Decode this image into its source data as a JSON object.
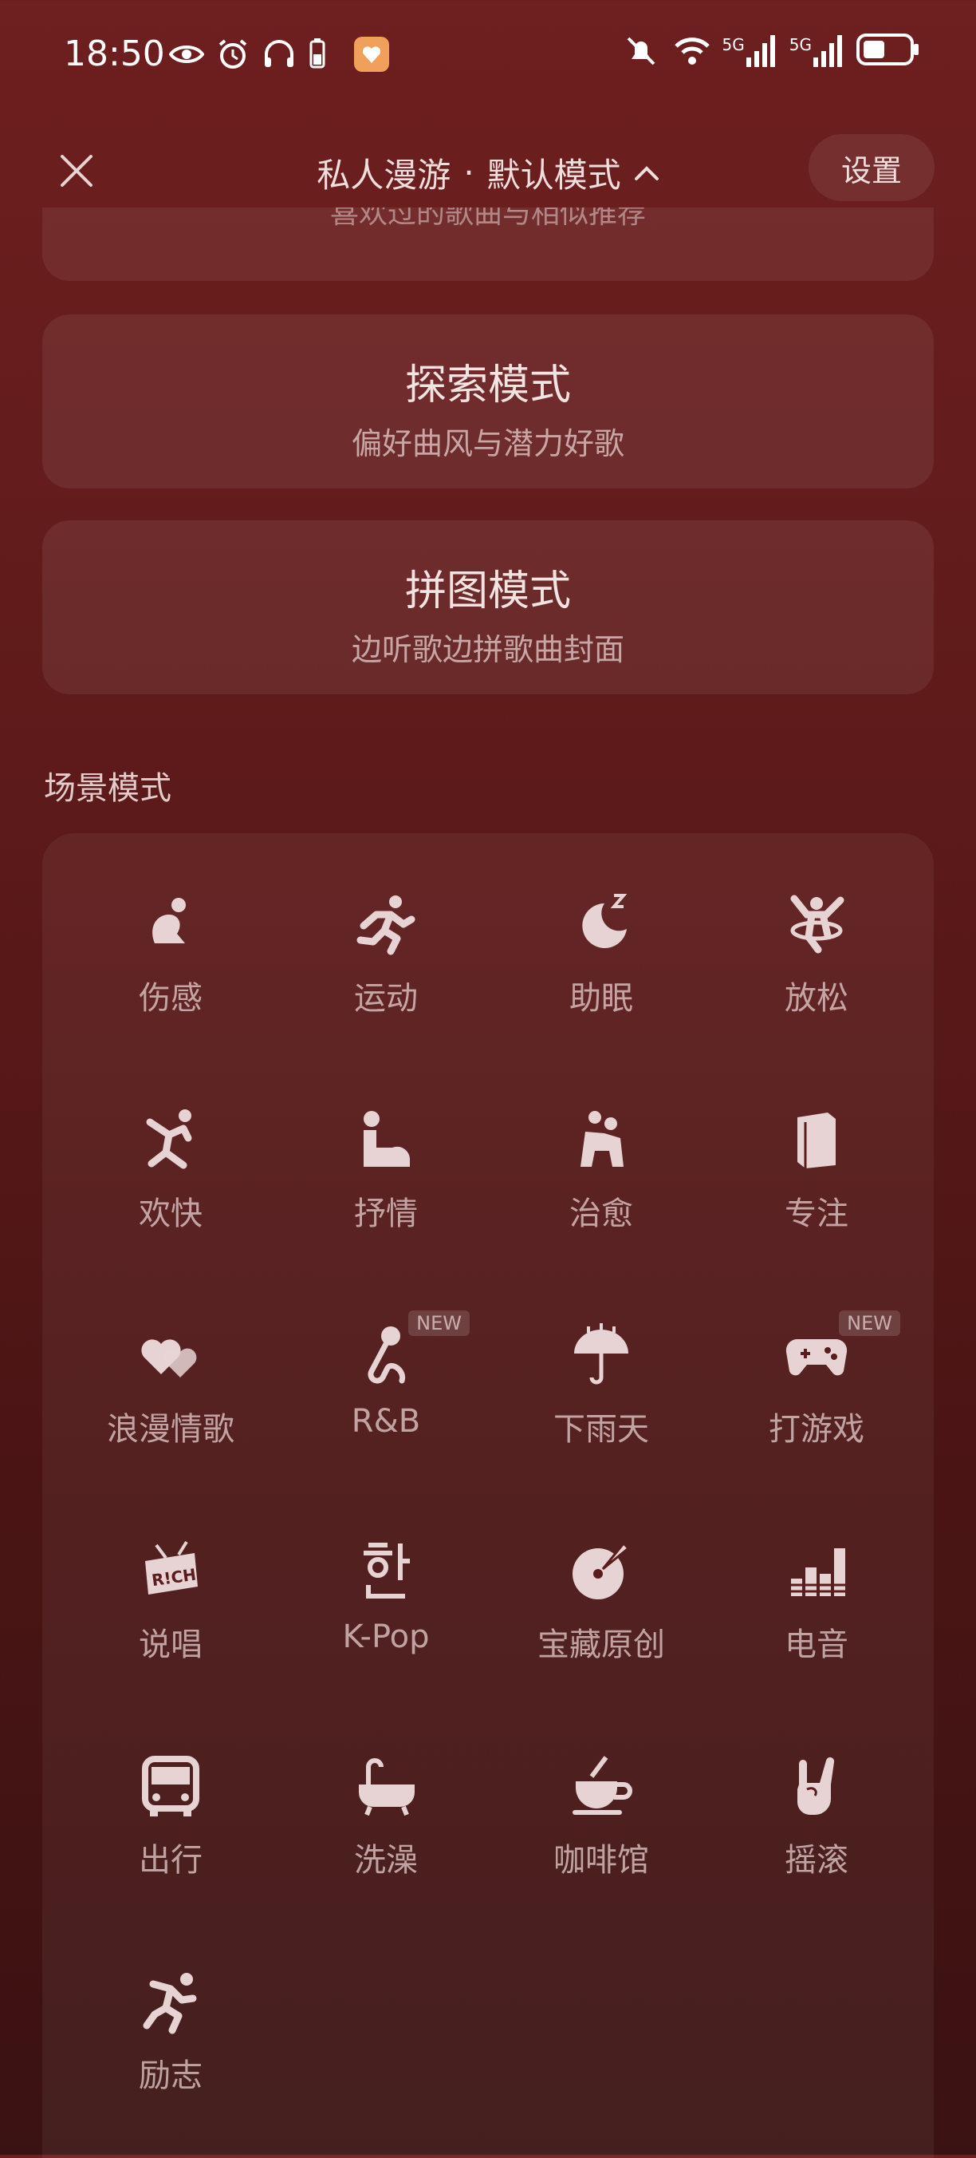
{
  "status": {
    "time": "18:50",
    "net_label_1": "5G",
    "net_label_2": "5G"
  },
  "header": {
    "title": "私人漫游",
    "separator": "·",
    "mode": "默认模式",
    "settings_label": "设置"
  },
  "modes": {
    "partial_sub": "喜欢过的歌曲与相似推荐",
    "explore": {
      "title": "探索模式",
      "sub": "偏好曲风与潜力好歌"
    },
    "puzzle": {
      "title": "拼图模式",
      "sub": "边听歌边拼歌曲封面"
    }
  },
  "scene": {
    "section_title": "场景模式",
    "new_label": "NEW",
    "items": [
      {
        "label": "伤感",
        "icon": "sad-icon"
      },
      {
        "label": "运动",
        "icon": "running-icon"
      },
      {
        "label": "助眠",
        "icon": "sleep-moon-icon"
      },
      {
        "label": "放松",
        "icon": "relax-icon"
      },
      {
        "label": "欢快",
        "icon": "happy-dance-icon"
      },
      {
        "label": "抒情",
        "icon": "lyrical-icon"
      },
      {
        "label": "治愈",
        "icon": "hug-icon"
      },
      {
        "label": "专注",
        "icon": "book-icon"
      },
      {
        "label": "浪漫情歌",
        "icon": "hearts-icon"
      },
      {
        "label": "R&B",
        "icon": "microphone-icon"
      },
      {
        "label": "下雨天",
        "icon": "umbrella-icon"
      },
      {
        "label": "打游戏",
        "icon": "gamepad-icon"
      },
      {
        "label": "说唱",
        "icon": "rap-badge-icon"
      },
      {
        "label": "K-Pop",
        "icon": "hangul-icon"
      },
      {
        "label": "宝藏原创",
        "icon": "vinyl-icon"
      },
      {
        "label": "电音",
        "icon": "equalizer-icon"
      },
      {
        "label": "出行",
        "icon": "bus-icon"
      },
      {
        "label": "洗澡",
        "icon": "bathtub-icon"
      },
      {
        "label": "咖啡馆",
        "icon": "coffee-icon"
      },
      {
        "label": "摇滚",
        "icon": "rock-hand-icon"
      },
      {
        "label": "励志",
        "icon": "sprint-icon"
      }
    ]
  },
  "colors": {
    "background_top": "#6e1f1f",
    "background_bottom": "#3b1212",
    "icon_fill": "#e7d3d3",
    "battery_brand": "#f0a05a"
  }
}
